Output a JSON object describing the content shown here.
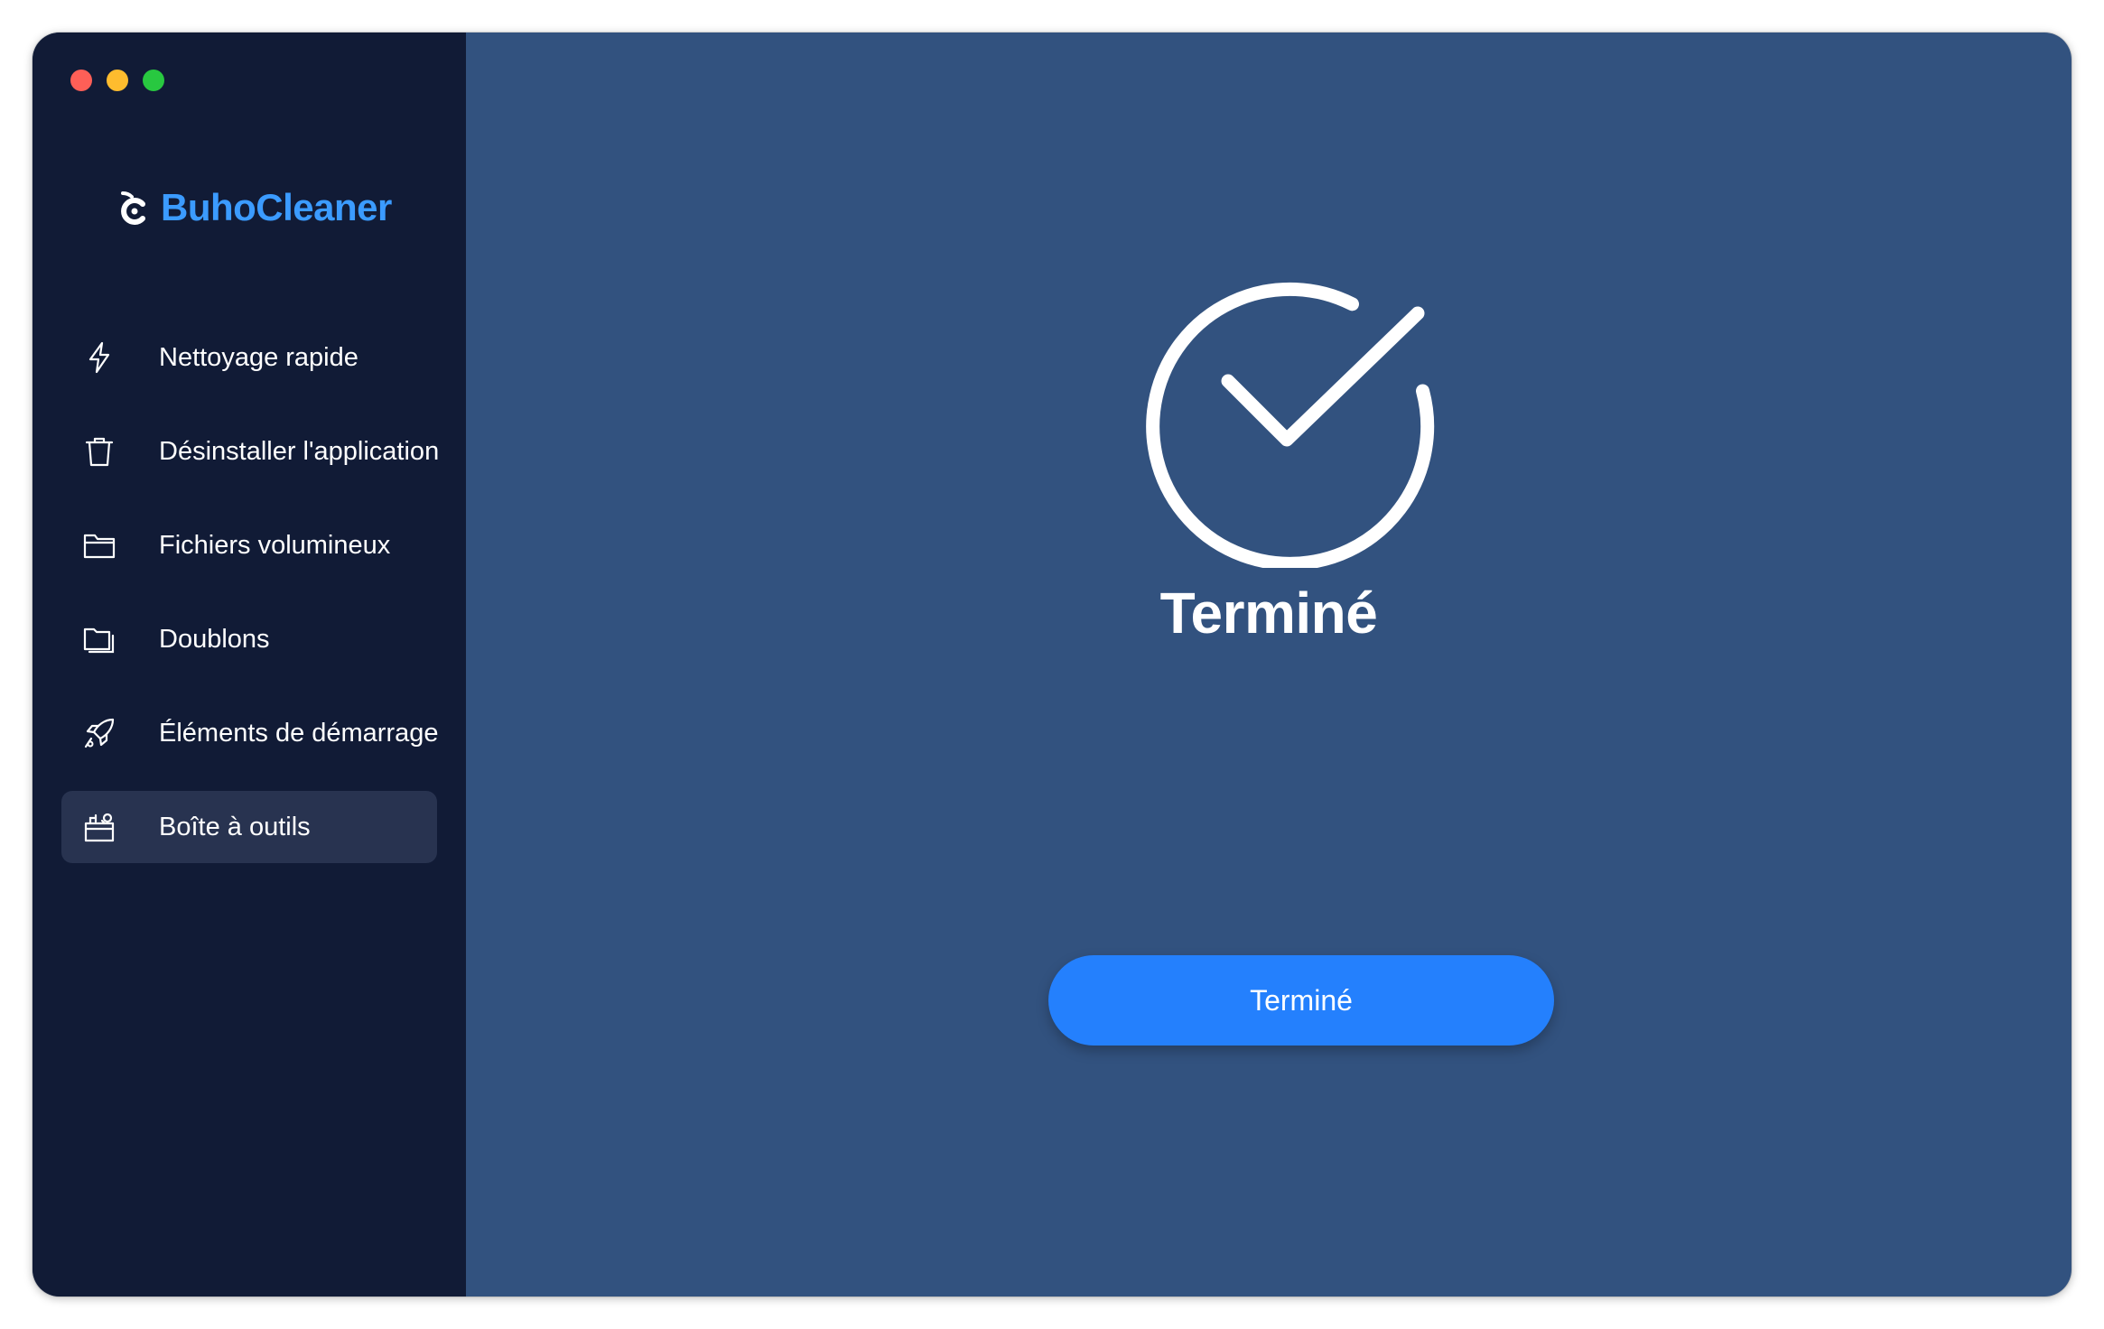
{
  "window": {
    "controls": [
      "close",
      "minimize",
      "maximize"
    ]
  },
  "app": {
    "name": "BuhoCleaner",
    "logo_icon": "buho-owl-logo-icon",
    "brand_color": "#3b9bff"
  },
  "sidebar": {
    "items": [
      {
        "label": "Nettoyage rapide",
        "icon": "lightning-icon",
        "active": false
      },
      {
        "label": "Désinstaller l'application",
        "icon": "trash-icon",
        "active": false
      },
      {
        "label": "Fichiers volumineux",
        "icon": "folder-icon",
        "active": false
      },
      {
        "label": "Doublons",
        "icon": "duplicate-folder-icon",
        "active": false
      },
      {
        "label": "Éléments de démarrage",
        "icon": "rocket-icon",
        "active": false
      },
      {
        "label": "Boîte à outils",
        "icon": "toolbox-icon",
        "active": true
      }
    ]
  },
  "main": {
    "status_icon": "checkmark-circle-icon",
    "status_title": "Terminé",
    "done_button_label": "Terminé"
  },
  "colors": {
    "sidebar_bg": "#111b36",
    "content_bg": "#32527f",
    "active_item_bg": "#283350",
    "button_bg": "#2480fd"
  }
}
